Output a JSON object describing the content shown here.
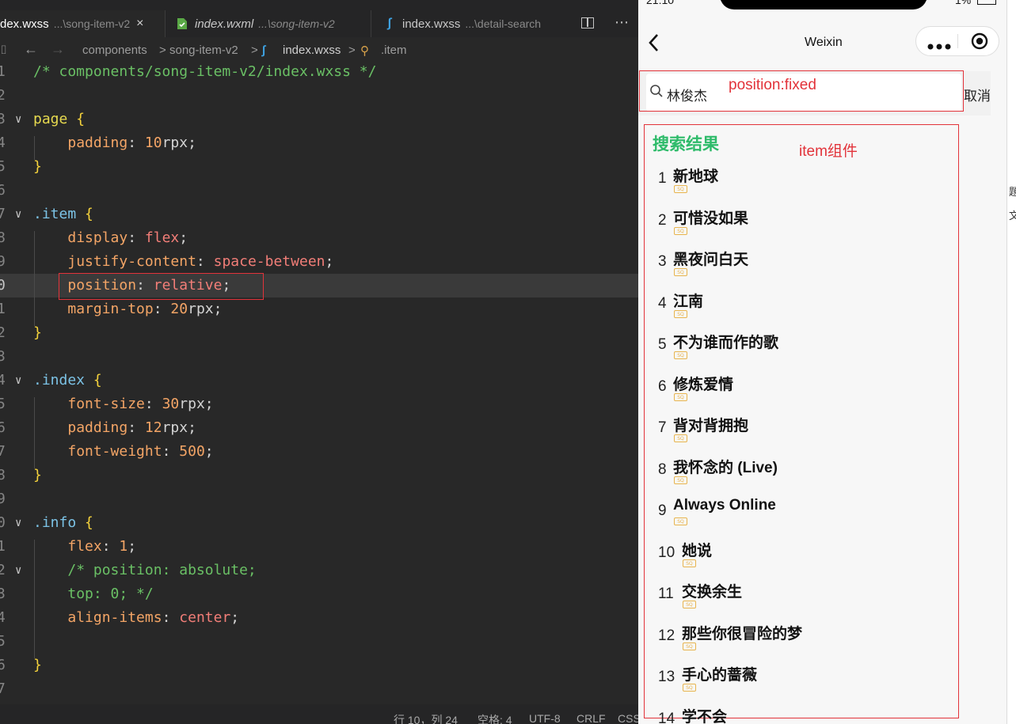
{
  "editor": {
    "tabs": [
      {
        "name": "dex.wxss",
        "path": "...\\song-item-v2",
        "close": "×"
      },
      {
        "name": "index.wxml",
        "path": "...\\song-item-v2"
      },
      {
        "name": "index.wxss",
        "path": "...\\detail-search"
      }
    ],
    "breadcrumb": [
      "components",
      ">",
      "song-item-v2",
      ">",
      "index.wxss",
      ">",
      ".item"
    ],
    "code_lines": [
      {
        "n": "1",
        "tokens": [
          [
            "com",
            "/* components/song-item-v2/index.wxss */"
          ]
        ]
      },
      {
        "n": "2",
        "tokens": []
      },
      {
        "n": "3",
        "fold": true,
        "tokens": [
          [
            "sel",
            "page"
          ],
          [
            "pun",
            " "
          ],
          [
            "br",
            "{"
          ]
        ]
      },
      {
        "n": "4",
        "tokens": [
          [
            "pun",
            "    "
          ],
          [
            "prop",
            "padding"
          ],
          [
            "pun",
            ": "
          ],
          [
            "num",
            "10"
          ],
          [
            "pun",
            "rpx;"
          ]
        ]
      },
      {
        "n": "5",
        "tokens": [
          [
            "br",
            "}"
          ]
        ]
      },
      {
        "n": "6",
        "tokens": []
      },
      {
        "n": "7",
        "fold": true,
        "tokens": [
          [
            "cls",
            ".item"
          ],
          [
            "pun",
            " "
          ],
          [
            "br",
            "{"
          ]
        ]
      },
      {
        "n": "8",
        "tokens": [
          [
            "pun",
            "    "
          ],
          [
            "prop",
            "display"
          ],
          [
            "pun",
            ": "
          ],
          [
            "val",
            "flex"
          ],
          [
            "pun",
            ";"
          ]
        ]
      },
      {
        "n": "9",
        "tokens": [
          [
            "pun",
            "    "
          ],
          [
            "prop",
            "justify-content"
          ],
          [
            "pun",
            ": "
          ],
          [
            "val",
            "space-between"
          ],
          [
            "pun",
            ";"
          ]
        ]
      },
      {
        "n": "0",
        "hl": true,
        "tokens": [
          [
            "pun",
            "    "
          ],
          [
            "prop",
            "position"
          ],
          [
            "pun",
            ": "
          ],
          [
            "val",
            "relative"
          ],
          [
            "pun",
            ";"
          ]
        ]
      },
      {
        "n": "1",
        "tokens": [
          [
            "pun",
            "    "
          ],
          [
            "prop",
            "margin-top"
          ],
          [
            "pun",
            ": "
          ],
          [
            "num",
            "20"
          ],
          [
            "pun",
            "rpx;"
          ]
        ]
      },
      {
        "n": "2",
        "tokens": [
          [
            "br",
            "}"
          ]
        ]
      },
      {
        "n": "3",
        "tokens": []
      },
      {
        "n": "4",
        "fold": true,
        "tokens": [
          [
            "cls",
            ".index"
          ],
          [
            "pun",
            " "
          ],
          [
            "br",
            "{"
          ]
        ]
      },
      {
        "n": "5",
        "tokens": [
          [
            "pun",
            "    "
          ],
          [
            "prop",
            "font-size"
          ],
          [
            "pun",
            ": "
          ],
          [
            "num",
            "30"
          ],
          [
            "pun",
            "rpx;"
          ]
        ]
      },
      {
        "n": "6",
        "tokens": [
          [
            "pun",
            "    "
          ],
          [
            "prop",
            "padding"
          ],
          [
            "pun",
            ": "
          ],
          [
            "num",
            "12"
          ],
          [
            "pun",
            "rpx;"
          ]
        ]
      },
      {
        "n": "7",
        "tokens": [
          [
            "pun",
            "    "
          ],
          [
            "prop",
            "font-weight"
          ],
          [
            "pun",
            ": "
          ],
          [
            "num",
            "500"
          ],
          [
            "pun",
            ";"
          ]
        ]
      },
      {
        "n": "8",
        "tokens": [
          [
            "br",
            "}"
          ]
        ]
      },
      {
        "n": "9",
        "tokens": []
      },
      {
        "n": "0",
        "fold": true,
        "tokens": [
          [
            "cls",
            ".info"
          ],
          [
            "pun",
            " "
          ],
          [
            "br",
            "{"
          ]
        ]
      },
      {
        "n": "1",
        "tokens": [
          [
            "pun",
            "    "
          ],
          [
            "prop",
            "flex"
          ],
          [
            "pun",
            ": "
          ],
          [
            "num",
            "1"
          ],
          [
            "pun",
            ";"
          ]
        ]
      },
      {
        "n": "2",
        "fold": true,
        "tokens": [
          [
            "pun",
            "    "
          ],
          [
            "com",
            "/* position: absolute;"
          ]
        ]
      },
      {
        "n": "3",
        "tokens": [
          [
            "pun",
            "    "
          ],
          [
            "com",
            "top: 0; */"
          ]
        ]
      },
      {
        "n": "4",
        "tokens": [
          [
            "pun",
            "    "
          ],
          [
            "prop",
            "align-items"
          ],
          [
            "pun",
            ": "
          ],
          [
            "val",
            "center"
          ],
          [
            "pun",
            ";"
          ]
        ]
      },
      {
        "n": "5",
        "tokens": []
      },
      {
        "n": "6",
        "tokens": [
          [
            "br",
            "}"
          ]
        ]
      },
      {
        "n": "7",
        "tokens": []
      }
    ],
    "status": {
      "position": "行 10，列 24",
      "spaces": "空格: 4",
      "encoding": "UTF-8",
      "eol": "CRLF",
      "lang": "CSS"
    }
  },
  "phone": {
    "status_time": "21:10",
    "battery": "1%",
    "nav_title": "Weixin",
    "search_value": "林俊杰",
    "cancel_label": "取消",
    "annotation_fixed": "position:fixed",
    "annotation_item": "item组件",
    "results_title": "搜索结果",
    "sq_badge": "SQ",
    "songs": [
      {
        "index": "1",
        "name": "新地球"
      },
      {
        "index": "2",
        "name": "可惜没如果"
      },
      {
        "index": "3",
        "name": "黑夜问白天"
      },
      {
        "index": "4",
        "name": "江南"
      },
      {
        "index": "5",
        "name": "不为谁而作的歌"
      },
      {
        "index": "6",
        "name": "修炼爱情"
      },
      {
        "index": "7",
        "name": "背对背拥抱"
      },
      {
        "index": "8",
        "name": "我怀念的 (Live)"
      },
      {
        "index": "9",
        "name": "Always Online"
      },
      {
        "index": "10",
        "name": "她说"
      },
      {
        "index": "11",
        "name": "交换余生"
      },
      {
        "index": "12",
        "name": "那些你很冒险的梦"
      },
      {
        "index": "13",
        "name": "手心的蔷薇"
      },
      {
        "index": "14",
        "name": "学不会"
      }
    ],
    "colors": {
      "accent_green": "#2ebb6a",
      "annotation_red": "#e2333a"
    }
  },
  "right_strip": [
    "題",
    "文"
  ]
}
